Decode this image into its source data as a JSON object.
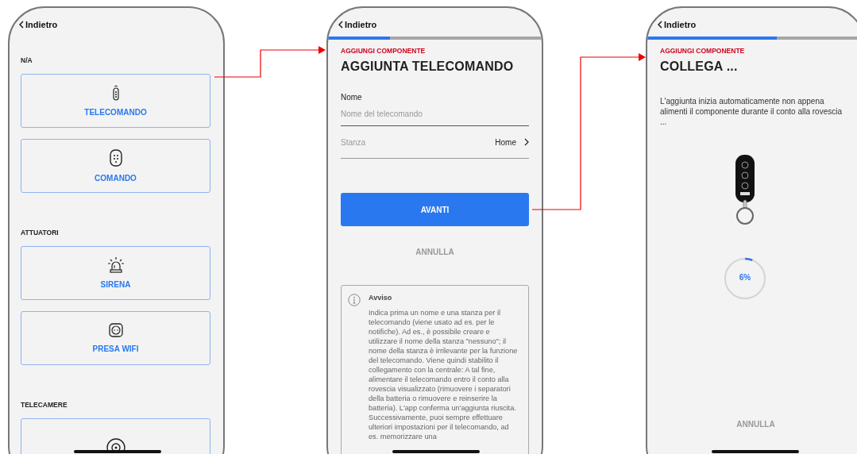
{
  "screens": [
    {
      "kind": "list",
      "back": "Indietro",
      "sections": [
        {
          "title": "N/A",
          "items": [
            {
              "kind": "remote",
              "label": "TELECOMANDO"
            },
            {
              "kind": "keypad",
              "label": "COMANDO"
            }
          ]
        },
        {
          "title": "ATTUATORI",
          "items": [
            {
              "kind": "siren",
              "label": "SIRENA"
            },
            {
              "kind": "socket",
              "label": "PRESA WIFI"
            }
          ]
        },
        {
          "title": "TELECAMERE",
          "items": [
            {
              "kind": "camera"
            }
          ]
        }
      ]
    },
    {
      "kind": "form",
      "back": "Indietro",
      "progress": {
        "level": 0.29
      },
      "overline": "AGGIUNGI COMPONENTE",
      "title": "AGGIUNTA TELECOMANDO",
      "name_field": {
        "label": "Nome",
        "placeholder": "Nome del telecomando"
      },
      "room_field": {
        "label": "Stanza",
        "value": "Home"
      },
      "primary_button": "AVANTI",
      "cancel_button": "ANNULLA",
      "notice": {
        "title": "Avviso",
        "text": "Indica prima un nome e una stanza per il telecomando (viene usato ad es. per le notifiche). Ad es., è possibile creare e utilizzare il nome della stanza \"nessuno\"; il nome della stanza è irrilevante per la funzione del telecomando. Viene quindi stabilito il collegamento con la centrale: A tal fine, alimentare il telecomando entro il conto alla rovescia visualizzato (rimuovere i separatori della batteria o rimuovere e reinserire la batteria). L'app conferma un'aggiunta riuscita. Successivamente, puoi sempre effettuare ulteriori impostazioni per il telecomando, ad es. memorizzare una"
      }
    },
    {
      "kind": "connect",
      "back": "Indietro",
      "progress": {
        "level": 0.6
      },
      "overline": "AGGIUNGI COMPONENTE",
      "title": "COLLEGA ...",
      "description": "L'aggiunta inizia automaticamente non appena alimenti il componente durante il conto alla rovescia ...",
      "countdown": {
        "level": 0.06,
        "reading": "6%"
      },
      "cancel_button": "ANNULLA"
    }
  ]
}
